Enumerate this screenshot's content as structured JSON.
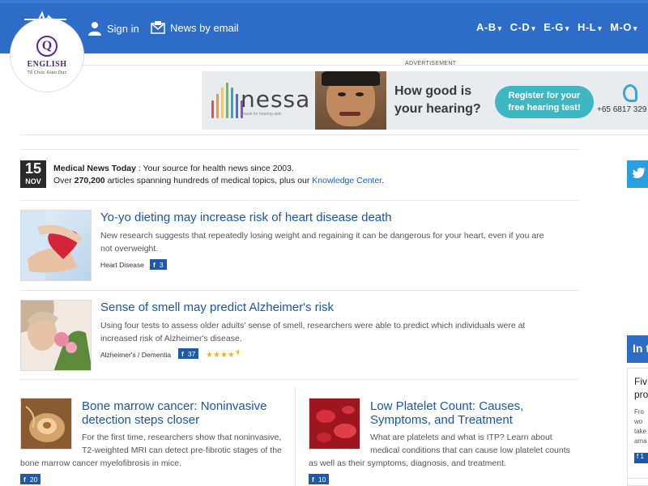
{
  "header": {
    "sign_in": "Sign in",
    "news_by_email": "News by email",
    "az": [
      "A-B",
      "C-D",
      "E-G",
      "H-L",
      "M-O"
    ]
  },
  "badge": {
    "letter": "Q",
    "name": "ENGLISH",
    "sub": "Tổ Chức Giáo Dục"
  },
  "ad": {
    "label": "ADVERTISEMENT",
    "brand": "nessa",
    "tagline": "made for hearing aids",
    "question_line1": "How good is",
    "question_line2": "your hearing?",
    "cta_line1": "Register for your",
    "cta_line2": "free hearing test!",
    "phone": "+65 6817 329",
    "colors": {
      "cta": "#3fb7c2",
      "background": "#e9ecef"
    }
  },
  "intro": {
    "day": "15",
    "month": "NOV",
    "site": "Medical News Today",
    "tagline": " : Your source for health news since 2003.",
    "line2_prefix": "Over ",
    "article_count": "270,200",
    "line2_mid": " articles spanning hundreds of medical topics, plus our ",
    "knowledge_link": "Knowledge Center",
    "line2_suffix": "."
  },
  "articles": [
    {
      "title": "Yo-yo dieting may increase risk of heart disease death",
      "desc_line1": "New research suggests that repeatedly losing weight and regaining it can be dangerous for your heart, even if you are",
      "desc_line2": "not overweight.",
      "category": "Heart Disease",
      "fb_count": "3"
    },
    {
      "title": "Sense of smell may predict Alzheimer's risk",
      "desc_line1": "Using four tests to assess older adults' sense of smell, researchers were able to predict which individuals were at",
      "desc_line2": "increased risk of Alzheimer's disease.",
      "category": "Alzheimer's / Dementia",
      "fb_count": "37",
      "rating": 4.5
    },
    {
      "title_line1": "Bone marrow cancer: Noninvasive",
      "title_line2": "detection steps closer",
      "desc_line1": "For the first time, researchers show that noninvasive,",
      "desc_line2": "T2-weighted MRI can detect pre-fibrotic stages of the",
      "desc_line3": "bone marrow cancer myelofibrosis in mice.",
      "fb_count": "20"
    },
    {
      "title_line1": "Low Platelet Count: Causes,",
      "title_line2": "Symptoms, and Treatment",
      "desc_line1": "What are platelets and what is ITP? Learn about",
      "desc_line2": "medical conditions that can cause low platelet counts",
      "desc_line3": "as well as their symptoms, diagnosis, and treatment.",
      "fb_count": "10"
    }
  ],
  "sidebar": {
    "header_partial": "In t",
    "title_partial_1": "Fiv",
    "title_partial_2": "pro",
    "text_partial_1": "Fro",
    "text_partial_2": "wo",
    "text_partial_3": "take",
    "text_partial_4": "ama",
    "fb_partial": "1"
  },
  "icons": {
    "user": "user-icon",
    "mail": "mail-icon",
    "facebook": "facebook-icon",
    "twitter": "twitter-icon",
    "star": "star-icon"
  }
}
